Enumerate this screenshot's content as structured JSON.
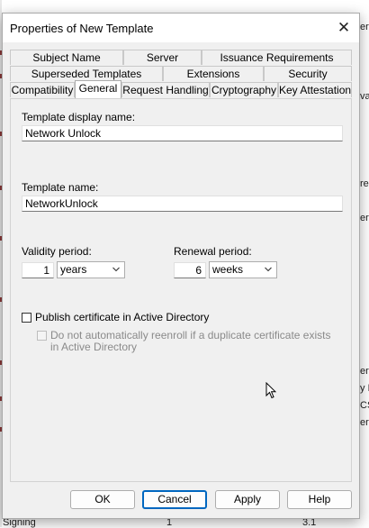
{
  "dialog": {
    "title": "Properties of New Template",
    "close_glyph": "✕"
  },
  "tabs": {
    "row1": [
      "Subject Name",
      "Server",
      "Issuance Requirements"
    ],
    "row2": [
      "Superseded Templates",
      "Extensions",
      "Security"
    ],
    "row3": [
      "Compatibility",
      "General",
      "Request Handling",
      "Cryptography",
      "Key Attestation"
    ],
    "active": "General"
  },
  "general": {
    "display_name_label": "Template display name:",
    "display_name_value": "Network Unlock",
    "template_name_label": "Template name:",
    "template_name_value": "NetworkUnlock",
    "validity_label": "Validity period:",
    "validity_value": "1",
    "validity_unit": "years",
    "renewal_label": "Renewal period:",
    "renewal_value": "6",
    "renewal_unit": "weeks",
    "publish_label": "Publish certificate in Active Directory",
    "publish_checked": false,
    "reenroll_label": "Do not automatically reenroll if a duplicate certificate exists in Active Directory",
    "reenroll_checked": false,
    "reenroll_enabled": false
  },
  "buttons": {
    "ok": "OK",
    "cancel": "Cancel",
    "apply": "Apply",
    "help": "Help"
  },
  "background": {
    "right_fragments": [
      "er",
      "va",
      "rec",
      "er",
      "er",
      "y I",
      "CS",
      "er"
    ],
    "bottom_fragments": [
      "Signing",
      "1",
      "3.1"
    ]
  },
  "colors": {
    "accent": "#0067c0",
    "dialog_bg": "#f0f0f0"
  }
}
